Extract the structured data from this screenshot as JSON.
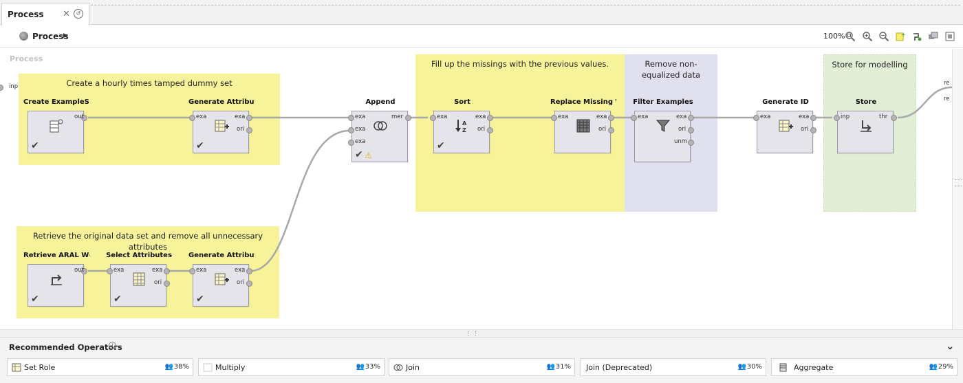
{
  "tab": {
    "label": "Process",
    "close": "✕"
  },
  "breadcrumb": {
    "label": "Process",
    "caret": "▶"
  },
  "toolbar": {
    "zoom": "100%"
  },
  "canvas": {
    "title": "Process",
    "input_port": "inp",
    "output_ports": [
      "re",
      "re"
    ]
  },
  "notes": {
    "create_dummy": "Create a hourly times tamped dummy set",
    "retrieve_original": "Retrieve the original data set and remove all unnecessary attributes",
    "fill_missings": "Fill up the missings with the previous values.",
    "remove_non_equalized": "Remove non-equalized data",
    "store_modelling": "Store for modelling"
  },
  "operators": {
    "create_exampleset": {
      "title": "Create ExampleSet",
      "ports_out": [
        "out"
      ]
    },
    "generate_attributes_1": {
      "title": "Generate Attributes",
      "ports_in": [
        "exa"
      ],
      "ports_out": [
        "exa",
        "ori"
      ]
    },
    "append": {
      "title": "Append",
      "ports_in": [
        "exa",
        "exa",
        "exa"
      ],
      "ports_out": [
        "mer"
      ]
    },
    "sort": {
      "title": "Sort",
      "ports_in": [
        "exa"
      ],
      "ports_out": [
        "exa",
        "ori"
      ]
    },
    "replace_missing": {
      "title": "Replace Missing Val...",
      "ports_in": [
        "exa"
      ],
      "ports_out": [
        "exa",
        "ori"
      ]
    },
    "filter_examples": {
      "title": "Filter Examples",
      "ports_in": [
        "exa"
      ],
      "ports_out": [
        "exa",
        "ori",
        "unm"
      ]
    },
    "generate_id": {
      "title": "Generate ID",
      "ports_in": [
        "exa"
      ],
      "ports_out": [
        "exa",
        "ori"
      ]
    },
    "store": {
      "title": "Store",
      "ports_in": [
        "inp"
      ],
      "ports_out": [
        "thr"
      ]
    },
    "retrieve_aral": {
      "title": "Retrieve ARAL West...",
      "ports_out": [
        "out"
      ]
    },
    "select_attributes": {
      "title": "Select Attributes",
      "ports_in": [
        "exa"
      ],
      "ports_out": [
        "exa",
        "ori"
      ]
    },
    "generate_attributes_2": {
      "title": "Generate Attributes...",
      "ports_in": [
        "exa"
      ],
      "ports_out": [
        "exa",
        "ori"
      ]
    }
  },
  "recommended": {
    "title": "Recommended Operators",
    "items": [
      {
        "name": "Set Role",
        "pct": "38%"
      },
      {
        "name": "Multiply",
        "pct": "33%"
      },
      {
        "name": "Join",
        "pct": "31%"
      },
      {
        "name": "Join (Deprecated)",
        "pct": "30%"
      },
      {
        "name": "Aggregate",
        "pct": "29%"
      }
    ]
  },
  "colors": {
    "note_yellow": "#f7f39a",
    "note_lilac": "#e1e0ee",
    "note_green": "#e3eed6",
    "operator_body": "#e4e4ea"
  }
}
